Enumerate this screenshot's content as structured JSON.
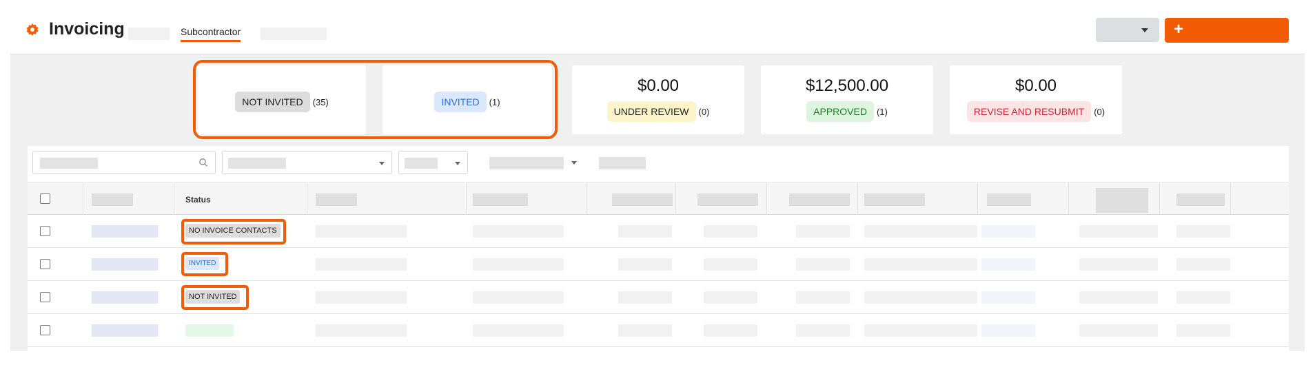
{
  "header": {
    "title": "Invoicing",
    "active_tab": "Subcontractor",
    "create_button": "+"
  },
  "summary": {
    "not_invited": {
      "label": "NOT INVITED",
      "count": "(35)"
    },
    "invited": {
      "label": "INVITED",
      "count": "(1)"
    },
    "under_review": {
      "amount": "$0.00",
      "label": "UNDER REVIEW",
      "count": "(0)"
    },
    "approved": {
      "amount": "$12,500.00",
      "label": "APPROVED",
      "count": "(1)"
    },
    "revise": {
      "amount": "$0.00",
      "label": "REVISE AND RESUBMIT",
      "count": "(0)"
    }
  },
  "table": {
    "status_header": "Status",
    "rows": [
      {
        "status": "NO INVOICE CONTACTS"
      },
      {
        "status": "INVITED"
      },
      {
        "status": "NOT INVITED"
      },
      {
        "status": ""
      }
    ]
  },
  "colors": {
    "accent": "#f25c05",
    "invited_text": "#2f6bd8",
    "approved_text": "#1f7a2a",
    "revise_text": "#d0243a"
  },
  "icons": [
    "gear-icon",
    "search-icon",
    "chevron-down-icon",
    "plus-icon"
  ]
}
